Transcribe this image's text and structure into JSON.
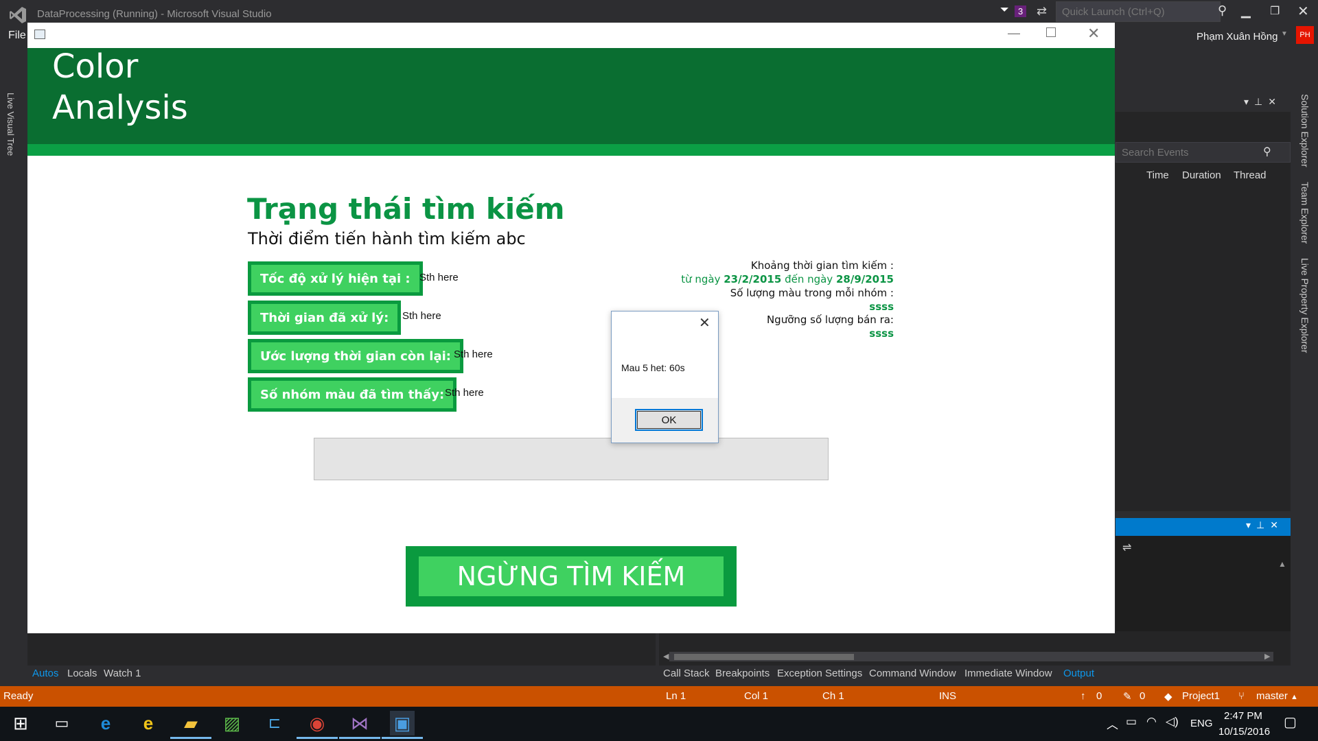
{
  "vs": {
    "title": "DataProcessing (Running) - Microsoft Visual Studio",
    "menu_file": "File",
    "notification_count": "3",
    "quick_launch_placeholder": "Quick Launch (Ctrl+Q)",
    "user_name": "Phạm Xuân Hồng",
    "user_initials": "PH",
    "left_tab": "Live Visual Tree",
    "right_tabs": [
      "Solution Explorer",
      "Team Explorer",
      "Live Property Explorer"
    ],
    "search_events_placeholder": "Search Events",
    "event_columns": [
      "Time",
      "Duration",
      "Thread"
    ],
    "bottom_left_tabs": [
      "Autos",
      "Locals",
      "Watch 1"
    ],
    "bottom_right_tabs": [
      "Call Stack",
      "Breakpoints",
      "Exception Settings",
      "Command Window",
      "Immediate Window",
      "Output"
    ],
    "status": {
      "ready": "Ready",
      "ln": "Ln 1",
      "col": "Col 1",
      "ch": "Ch 1",
      "ins": "INS",
      "up_count": "0",
      "edit_count": "0",
      "project": "Project1",
      "branch": "master"
    }
  },
  "taskbar": {
    "time": "2:47 PM",
    "date": "10/15/2016",
    "lang": "ENG"
  },
  "app": {
    "title_line1": "Color",
    "title_line2": "Analysis",
    "status_title": "Trạng thái tìm kiếm",
    "status_subtitle": "Thời điểm tiến hành tìm kiếm abc",
    "metrics": [
      {
        "label": "Tốc độ xử lý hiện tại :",
        "value": "Sth here"
      },
      {
        "label": "Thời gian đã xử lý:",
        "value": "Sth here"
      },
      {
        "label": "Ước lượng thời gian còn lại:",
        "value": "Sth here"
      },
      {
        "label": "Số nhóm màu đã tìm thấy:",
        "value": "Sth here"
      }
    ],
    "info": {
      "range_label": "Khoảng thời gian tìm kiếm :",
      "from_word": "từ ngày",
      "from_date": "23/2/2015",
      "to_word": "đến ngày",
      "to_date": "28/9/2015",
      "color_count_label": "Số lượng màu trong mỗi nhóm :",
      "color_count_value": "ssss",
      "threshold_label": "Ngưỡng số lượng bán ra:",
      "threshold_value": "ssss"
    },
    "stop_button": "NGỪNG TÌM KIẾM"
  },
  "msgbox": {
    "text": "Mau 5 het: 60s",
    "ok": "OK"
  },
  "colors": {
    "header_green": "#0a6e31",
    "accent_green": "#0b9444",
    "button_green": "#3fd160",
    "status_orange": "#ca5100"
  }
}
